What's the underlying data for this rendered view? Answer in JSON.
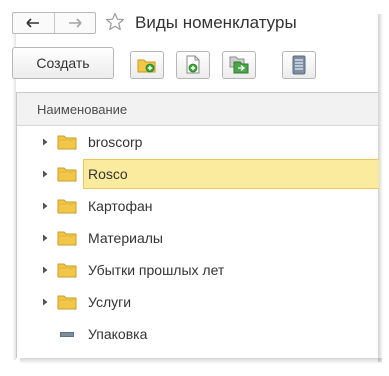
{
  "window": {
    "title": "Виды номенклатуры"
  },
  "toolbar": {
    "create_label": "Создать",
    "buttons": [
      {
        "icon": "create-group-icon"
      },
      {
        "icon": "copy-item-icon"
      },
      {
        "icon": "move-to-group-icon"
      },
      {
        "icon": "hierarchy-list-icon"
      }
    ]
  },
  "list": {
    "column_header": "Наименование",
    "rows": [
      {
        "label": "broscorp",
        "kind": "group",
        "selected": false
      },
      {
        "label": "Rosco",
        "kind": "group",
        "selected": true
      },
      {
        "label": "Картофан",
        "kind": "group",
        "selected": false
      },
      {
        "label": "Материалы",
        "kind": "group",
        "selected": false
      },
      {
        "label": "Убытки прошлых лет",
        "kind": "group",
        "selected": false
      },
      {
        "label": "Услуги",
        "kind": "group",
        "selected": false
      },
      {
        "label": "Упаковка",
        "kind": "item",
        "selected": false
      }
    ]
  },
  "colors": {
    "selection": "#fbeb9f",
    "folder": "#f3c64a",
    "add_green": "#3aa635"
  }
}
